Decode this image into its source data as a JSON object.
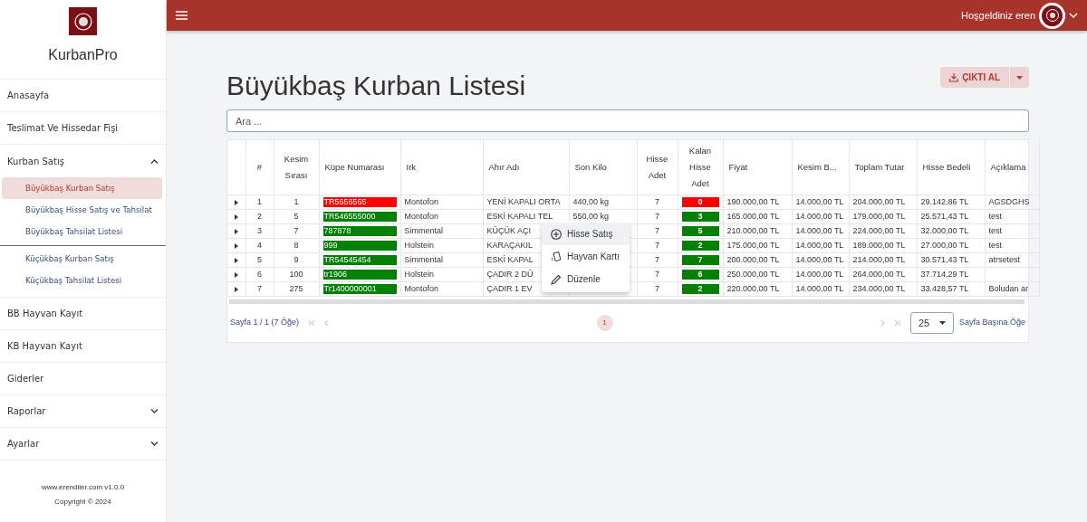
{
  "app": {
    "name": "KurbanPro",
    "footer_site": "www.erendiler.com v1.0.0",
    "footer_copyright": "Copyright © 2024"
  },
  "sidebar": {
    "items": [
      {
        "kind": "link",
        "label": "Anasayfa"
      },
      {
        "kind": "link",
        "label": "Teslimat Ve Hissedar Fişi"
      },
      {
        "kind": "group",
        "label": "Kurban Satış",
        "expanded": true,
        "children": [
          {
            "label": "Büyükbaş Kurban Satış",
            "selected": true
          },
          {
            "label": "Büyükbaş Hisse Satış ve Tahsilat",
            "selected": false
          },
          {
            "label": "Büyükbaş Tahsilat Listesi",
            "selected": false
          },
          {
            "label": "Küçükbaş Kurban Satış",
            "selected": false
          },
          {
            "label": "Küçükbaş Tahsilat Listesi",
            "selected": false
          }
        ]
      },
      {
        "kind": "link",
        "label": "BB Hayvan Kayıt"
      },
      {
        "kind": "link",
        "label": "KB Hayvan Kayıt"
      },
      {
        "kind": "link",
        "label": "Giderler"
      },
      {
        "kind": "group",
        "label": "Raporlar",
        "expanded": false
      },
      {
        "kind": "group",
        "label": "Ayarlar",
        "expanded": false
      }
    ]
  },
  "topbar": {
    "greeting": "Hoşgeldiniz eren"
  },
  "page": {
    "title": "Büyükbaş Kurban Listesi",
    "export_button": "ÇIKTI AL",
    "search": {
      "placeholder": "Ara ..."
    }
  },
  "table": {
    "columns": [
      "#",
      "Kesim Sırası",
      "Küpe Numarası",
      "Irk",
      "Ahır Adı",
      "Son Kilo",
      "Hisse Adet",
      "Kalan Hisse Adet",
      "Fiyat",
      "Kesim B...",
      "Toplam Tutar",
      "Hisse Bedeli",
      "Açıklama"
    ],
    "rows": [
      {
        "no": "1",
        "kesim": "1",
        "kupe": "TR5656565",
        "color": "#ff0000",
        "irk": "Montofon",
        "ahir": "YENİ KAPALI ORTA",
        "kilo": "440,00 kg",
        "hisse": "7",
        "kalan": "0",
        "fiyat": "190.000,00 TL",
        "kesim_bedeli": "14.000,00 TL",
        "toplam": "204.000,00 TL",
        "hisse_bedeli": "29.142,86 TL",
        "aciklama": "AGSDGHS"
      },
      {
        "no": "2",
        "kesim": "5",
        "kupe": "TR546555000",
        "color": "#008000",
        "irk": "Montofon",
        "ahir": "ESKİ KAPALI TEL",
        "kilo": "550,00 kg",
        "hisse": "7",
        "kalan": "3",
        "fiyat": "165.000,00 TL",
        "kesim_bedeli": "14.000,00 TL",
        "toplam": "179.000,00 TL",
        "hisse_bedeli": "25.571,43 TL",
        "aciklama": "test"
      },
      {
        "no": "3",
        "kesim": "7",
        "kupe": "787878",
        "color": "#008000",
        "irk": "Simmental",
        "ahir": "KÜÇÜK AÇI",
        "hisse": "7",
        "kalan": "5",
        "fiyat": "210.000,00 TL",
        "kesim_bedeli": "14.000,00 TL",
        "toplam": "224.000,00 TL",
        "hisse_bedeli": "32.000,00 TL",
        "aciklama": "test"
      },
      {
        "no": "4",
        "kesim": "8",
        "kupe": "999",
        "color": "#008000",
        "irk": "Holstein",
        "ahir": "KARAÇAKIL",
        "hisse": "7",
        "kalan": "2",
        "fiyat": "175.000,00 TL",
        "kesim_bedeli": "14.000,00 TL",
        "toplam": "189.000,00 TL",
        "hisse_bedeli": "27.000,00 TL",
        "aciklama": "test"
      },
      {
        "no": "5",
        "kesim": "9",
        "kupe": "TR54545454",
        "color": "#008000",
        "irk": "Simmental",
        "ahir": "ESKİ KAPAL",
        "hisse": "7",
        "kalan": "7",
        "fiyat": "200.000,00 TL",
        "kesim_bedeli": "14.000,00 TL",
        "toplam": "214.000,00 TL",
        "hisse_bedeli": "30.571,43 TL",
        "aciklama": "atrsetest"
      },
      {
        "no": "6",
        "kesim": "100",
        "kupe": "tr1906",
        "color": "#008000",
        "irk": "Holstein",
        "ahir": "ÇADIR 2 DÜ",
        "hisse": "7",
        "kalan": "6",
        "fiyat": "250.000,00 TL",
        "kesim_bedeli": "14.000,00 TL",
        "toplam": "264.000,00 TL",
        "hisse_bedeli": "37.714,29 TL"
      },
      {
        "no": "7",
        "kesim": "275",
        "kupe": "Tr1400000001",
        "color": "#008000",
        "irk": "Montofon",
        "ahir": "ÇADIR 1 EV",
        "hisse": "7",
        "kalan": "2",
        "fiyat": "220.000,00 TL",
        "kesim_bedeli": "14.000,00 TL",
        "toplam": "234.000,00 TL",
        "hisse_bedeli": "33.428,57 TL",
        "aciklama": "Boludan ar"
      }
    ]
  },
  "context_menu": {
    "items": [
      {
        "kind": "add",
        "label": "Hisse Satış",
        "selected": true
      },
      {
        "kind": "card",
        "label": "Hayvan Kartı",
        "selected": false
      },
      {
        "kind": "edit",
        "label": "Düzenle",
        "selected": false
      }
    ]
  },
  "pagination": {
    "summary": "Sayfa 1 / 1 (7 Öğe)",
    "nav": [
      {
        "kind": "first",
        "disabled": true
      },
      {
        "kind": "prev",
        "disabled": true
      },
      {
        "kind": "next",
        "disabled": true
      },
      {
        "kind": "last",
        "disabled": true
      }
    ],
    "pages": [
      {
        "label": "1",
        "selected": true
      }
    ],
    "page_size": "25",
    "page_size_label": "Sayfa Başına Öğe"
  }
}
